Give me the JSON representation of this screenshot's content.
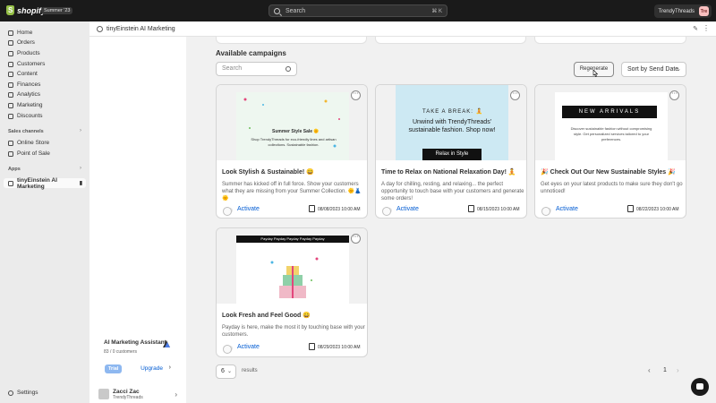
{
  "topbar": {
    "brand": "shopify",
    "edition": "Summer '23",
    "search_placeholder": "Search",
    "search_shortcut": "⌘ K",
    "store_name": "TrendyThreads",
    "store_initials": "Tre"
  },
  "sidebar": {
    "items": [
      {
        "label": "Home"
      },
      {
        "label": "Orders"
      },
      {
        "label": "Products"
      },
      {
        "label": "Customers"
      },
      {
        "label": "Content"
      },
      {
        "label": "Finances"
      },
      {
        "label": "Analytics"
      },
      {
        "label": "Marketing"
      },
      {
        "label": "Discounts"
      }
    ],
    "sales_channels_label": "Sales channels",
    "channels": [
      {
        "label": "Online Store"
      },
      {
        "label": "Point of Sale"
      }
    ],
    "apps_label": "Apps",
    "app_item": "tinyEinstein AI Marketing",
    "settings_label": "Settings"
  },
  "ai_card": {
    "title": "AI Marketing Assistant",
    "customers": "83 / 0 customers",
    "trial": "Trial",
    "upgrade": "Upgrade"
  },
  "user": {
    "name": "Zacci Zac",
    "store": "TrendyThreads"
  },
  "page": {
    "title": "tinyEinstein AI Marketing",
    "section_title": "Available campaigns",
    "filter_placeholder": "Search",
    "regenerate": "Regenerate",
    "sort": "Sort by Send Date",
    "page_size": "6",
    "results": "results",
    "current_page": "1"
  },
  "campaigns": [
    {
      "title": "Look Stylish & Sustainable! 😄",
      "desc": "Summer has kicked off in full force. Show your customers what they are missing from your Summer Collection. 🌞👗🌞",
      "activate": "Activate",
      "date": "08/08/2023 10:00 AM",
      "poster_heading": "Summer Style Sale 🌞",
      "poster_body": "Shop TrendyThreads for eco-friendly lines and artisan collections. Sustainable fashion."
    },
    {
      "title": "Time to Relax on National Relaxation Day! 🧘",
      "desc": "A day for chilling, resting, and relaxing... the perfect opportunity to touch base with your customers and generate some orders!",
      "activate": "Activate",
      "date": "08/15/2023 10:00 AM",
      "poster_heading": "TAKE A BREAK: 🧘",
      "poster_body": "Unwind with TrendyThreads' sustainable fashion. Shop now!",
      "poster_button": "Relax in Style"
    },
    {
      "title": "🎉 Check Out Our New Sustainable Styles 🎉",
      "desc": "Get eyes on your latest products to make sure they don't go unnoticed!",
      "activate": "Activate",
      "date": "08/22/2023 10:00 AM",
      "poster_heading": "NEW ARRIVALS",
      "poster_body": "Discover sustainable fashion without compromising style. Get personalized services tailored to your preferences."
    },
    {
      "title": "Look Fresh and Feel Good 😄",
      "desc": "Payday is here, make the most it by touching base with your customers.",
      "activate": "Activate",
      "date": "08/29/2023 10:00 AM",
      "poster_heading": "Payday Payday Payday Payday Payday"
    }
  ]
}
